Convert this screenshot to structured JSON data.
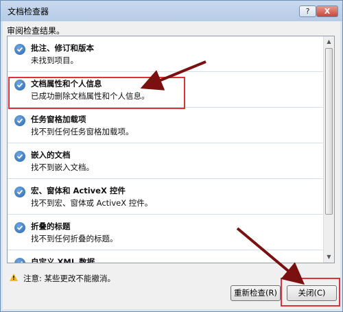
{
  "window": {
    "title": "文档检查器",
    "help_label": "?",
    "close_label": "X"
  },
  "subtitle": "审阅检查结果。",
  "results": [
    {
      "title": "批注、修订和版本",
      "desc": "未找到项目。"
    },
    {
      "title": "文档属性和个人信息",
      "desc": "已成功删除文档属性和个人信息。"
    },
    {
      "title": "任务窗格加载项",
      "desc": "找不到任何任务窗格加载项。"
    },
    {
      "title": "嵌入的文档",
      "desc": "找不到嵌入文档。"
    },
    {
      "title": "宏、窗体和 ActiveX 控件",
      "desc": "找不到宏、窗体或 ActiveX 控件。"
    },
    {
      "title": "折叠的标题",
      "desc": "找不到任何折叠的标题。"
    },
    {
      "title": "自定义 XML 数据",
      "desc": ""
    }
  ],
  "warning": "注意: 某些更改不能撤消。",
  "buttons": {
    "reinspect": "重新检查(R)",
    "close": "关闭(C)"
  },
  "colors": {
    "annotation": "#e0303a",
    "arrow": "#7a1010",
    "check": "#2a65b0"
  }
}
